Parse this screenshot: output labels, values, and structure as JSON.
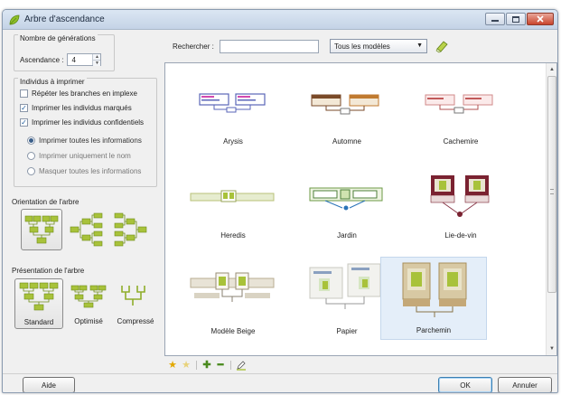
{
  "window": {
    "title": "Arbre d'ascendance"
  },
  "generations": {
    "group_title": "Nombre de générations",
    "label": "Ascendance :",
    "value": "4"
  },
  "individuals": {
    "group_title": "Individus à imprimer",
    "checkboxes": [
      {
        "label": "Répéter les branches en implexe",
        "checked": false
      },
      {
        "label": "Imprimer les individus marqués",
        "checked": true
      },
      {
        "label": "Imprimer les individus confidentiels",
        "checked": true
      }
    ],
    "radios": [
      {
        "label": "Imprimer toutes les informations",
        "selected": true
      },
      {
        "label": "Imprimer uniquement le nom",
        "selected": false
      },
      {
        "label": "Masquer toutes les informations",
        "selected": false
      }
    ]
  },
  "orientation": {
    "label": "Orientation de l'arbre"
  },
  "presentation": {
    "label": "Présentation de l'arbre",
    "options": [
      "Standard",
      "Optimisé",
      "Compressé"
    ],
    "selected": "Standard"
  },
  "search": {
    "label": "Rechercher :",
    "value": "",
    "filter_value": "Tous les modèles"
  },
  "templates": [
    {
      "name": "Arysis"
    },
    {
      "name": "Automne"
    },
    {
      "name": "Cachemire"
    },
    {
      "name": "Heredis"
    },
    {
      "name": "Jardin"
    },
    {
      "name": "Lie-de-vin"
    },
    {
      "name": "Modèle Beige"
    },
    {
      "name": "Papier"
    },
    {
      "name": "Parchemin"
    }
  ],
  "selected_template": "Parchemin",
  "buttons": {
    "help": "Aide",
    "ok": "OK",
    "cancel": "Annuler"
  },
  "colors": {
    "tree_green": "#a8c23a",
    "selection": "#e4eef9"
  }
}
